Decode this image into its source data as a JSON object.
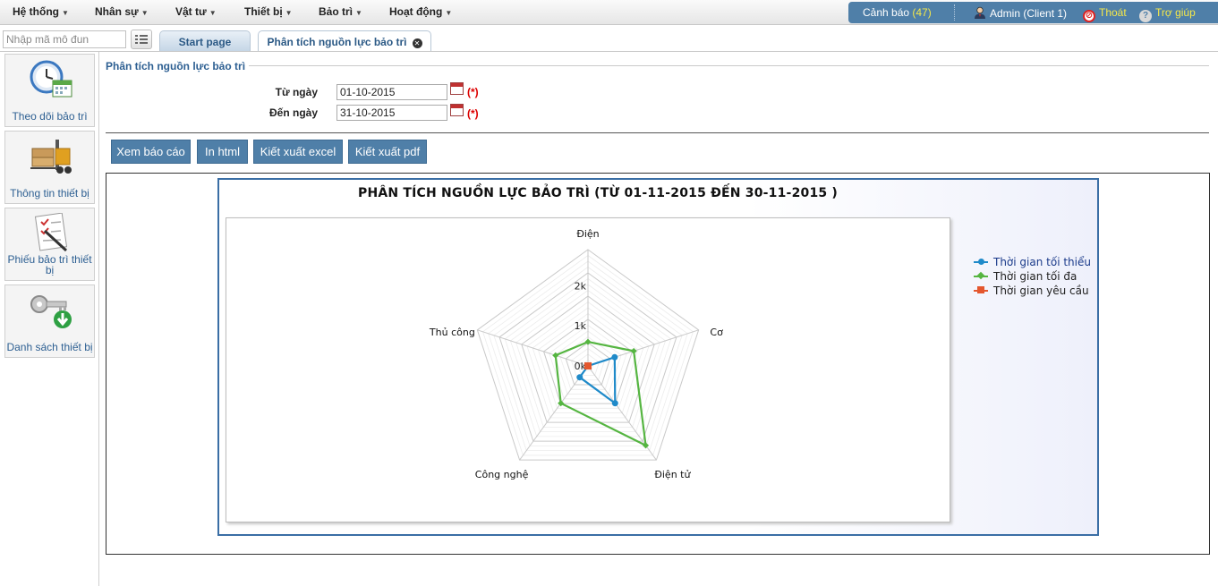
{
  "menu": [
    {
      "label": "Hệ thống"
    },
    {
      "label": "Nhân sự"
    },
    {
      "label": "Vật tư"
    },
    {
      "label": "Thiết bị"
    },
    {
      "label": "Bảo trì"
    },
    {
      "label": "Hoạt động"
    }
  ],
  "header_right": {
    "alerts_label": "Cảnh báo",
    "alerts_count": "(47)",
    "user": "Admin (Client 1)",
    "logout": "Thoát",
    "help": "Trợ giúp"
  },
  "search": {
    "placeholder": "Nhập mã mô đun"
  },
  "tabs": [
    {
      "label": "Start page",
      "active": false
    },
    {
      "label": "Phân tích nguồn lực bảo trì",
      "active": true
    }
  ],
  "sidebar": [
    {
      "label": "Theo dõi bảo trì",
      "icon": "clock-calendar-icon"
    },
    {
      "label": "Thông tin thiết bị",
      "icon": "forklift-icon"
    },
    {
      "label": "Phiếu bảo trì thiết bị",
      "icon": "checklist-pen-icon"
    },
    {
      "label": "Danh sách thiết bị",
      "icon": "key-download-icon"
    }
  ],
  "section_title": "Phân tích nguồn lực bảo trì",
  "form": {
    "from_label": "Từ ngày",
    "from_value": "01-10-2015",
    "to_label": "Đến ngày",
    "to_value": "31-10-2015",
    "required_mark": "(*)"
  },
  "actions": [
    {
      "label": "Xem báo cáo"
    },
    {
      "label": "In html"
    },
    {
      "label": "Kiết xuất excel"
    },
    {
      "label": "Kiết xuất pdf"
    }
  ],
  "chart_data": {
    "type": "radar",
    "title": "PHÂN TÍCH NGUỒN LỰC BẢO TRÌ (TỪ 01-11-2015 ĐẾN 30-11-2015 )",
    "categories": [
      "Điện",
      "Cơ",
      "Điện tử",
      "Công nghệ",
      "Thủ công"
    ],
    "radial_ticks": [
      "0k",
      "1k",
      "2k"
    ],
    "rmax": 2900,
    "grid": true,
    "legend_position": "right",
    "series": [
      {
        "name": "Thời gian tối thiểu",
        "color": "#1f8ac9",
        "marker": "circle",
        "values": [
          0,
          700,
          1150,
          350,
          0
        ]
      },
      {
        "name": "Thời gian tối đa",
        "color": "#55b541",
        "marker": "diamond",
        "values": [
          600,
          1200,
          2450,
          1150,
          850
        ]
      },
      {
        "name": "Thời gian yêu cầu",
        "color": "#e4572e",
        "marker": "square",
        "values": [
          0,
          0,
          0,
          0,
          0
        ]
      }
    ]
  }
}
